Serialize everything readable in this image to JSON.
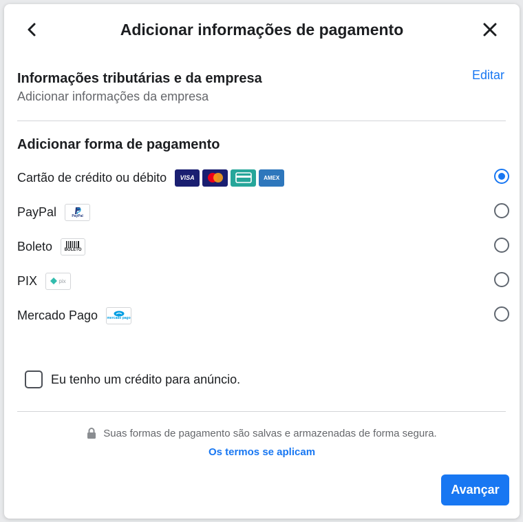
{
  "dialog": {
    "title": "Adicionar informações de pagamento",
    "back_icon": "chevron-left-icon",
    "close_icon": "close-icon"
  },
  "business_info": {
    "title": "Informações tributárias e da empresa",
    "subtitle": "Adicionar informações da empresa",
    "edit_label": "Editar"
  },
  "payment": {
    "title": "Adicionar forma de pagamento",
    "options": [
      {
        "label": "Cartão de crédito ou débito",
        "selected": true,
        "icons": [
          "visa-icon",
          "mastercard-icon",
          "generic-card-icon",
          "amex-icon"
        ],
        "icon_text": [
          "VISA",
          "",
          "",
          "AMEX"
        ]
      },
      {
        "label": "PayPal",
        "selected": false,
        "icons": [
          "paypal-icon"
        ],
        "icon_text": [
          "PayPal"
        ]
      },
      {
        "label": "Boleto",
        "selected": false,
        "icons": [
          "boleto-icon"
        ],
        "icon_text": [
          "BOLETO"
        ]
      },
      {
        "label": "PIX",
        "selected": false,
        "icons": [
          "pix-icon"
        ],
        "icon_text": [
          "pix"
        ]
      },
      {
        "label": "Mercado Pago",
        "selected": false,
        "icons": [
          "mercado-pago-icon"
        ],
        "icon_text": [
          "mercado pago"
        ]
      }
    ]
  },
  "credit": {
    "label": "Eu tenho um crédito para anúncio.",
    "checked": false
  },
  "footer": {
    "secure_text": "Suas formas de pagamento são salvas e armazenadas de forma segura.",
    "terms_link": "Os termos se aplicam",
    "next_label": "Avançar"
  },
  "colors": {
    "accent": "#1877f2",
    "text": "#1c1e21",
    "secondary_text": "#65676b"
  }
}
